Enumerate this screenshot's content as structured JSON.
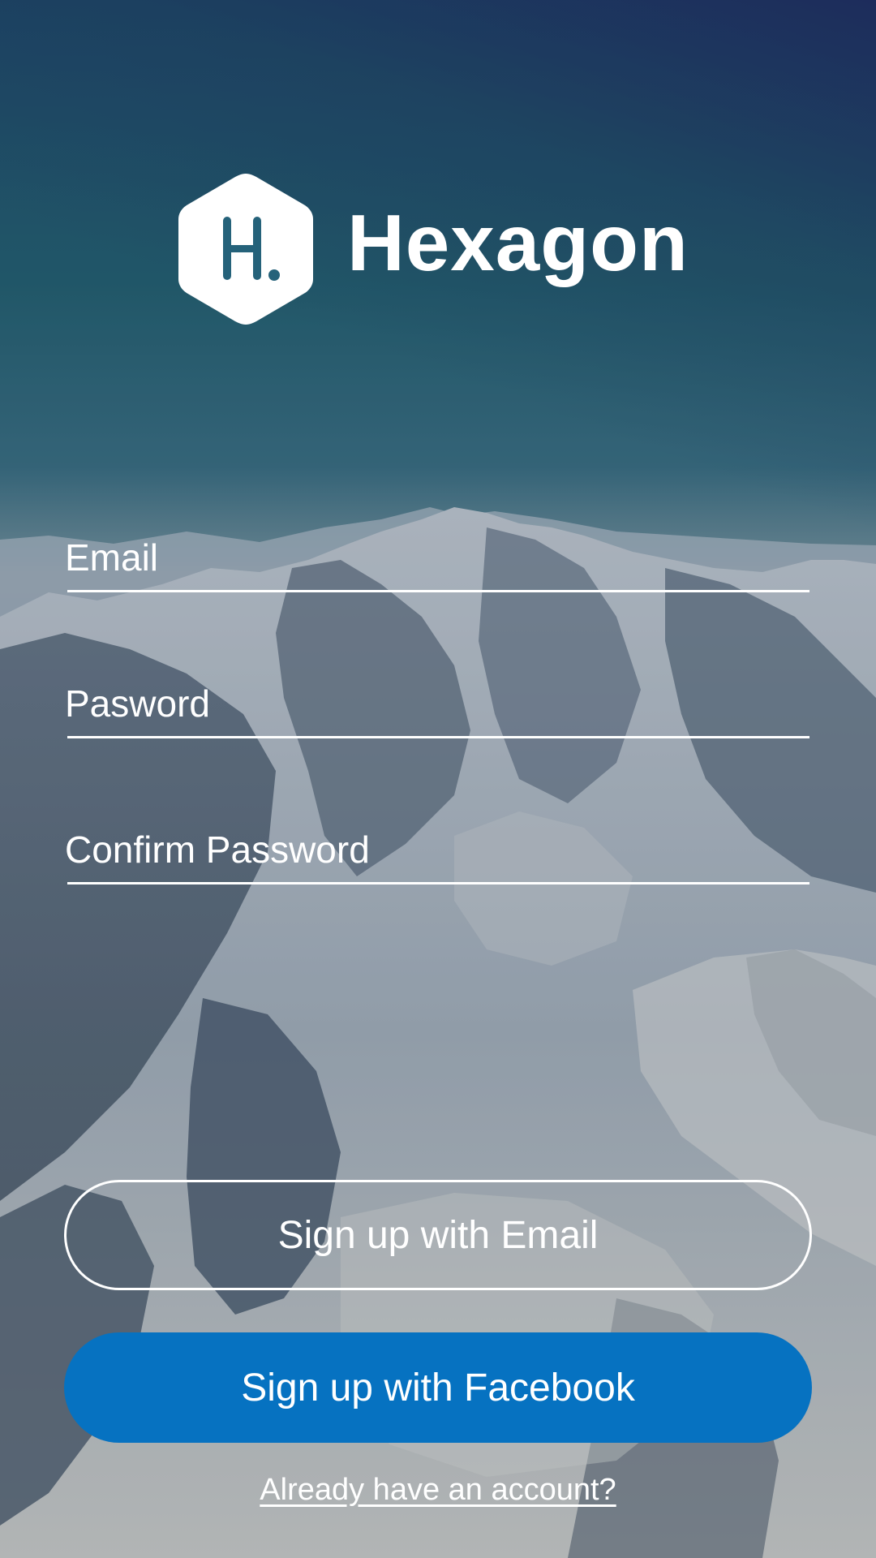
{
  "brand": {
    "logo_letter": "H.",
    "name": "Hexagon"
  },
  "form": {
    "email_placeholder": "Email",
    "password_placeholder": "Pasword",
    "confirm_password_placeholder": "Confirm Password"
  },
  "buttons": {
    "signup_email_label": "Sign up with Email",
    "signup_facebook_label": "Sign up with Facebook"
  },
  "footer": {
    "login_link_label": "Already have an account?"
  },
  "colors": {
    "facebook_blue": "#0672c1",
    "text": "#ffffff"
  },
  "icons": {
    "logo": "hexagon-logo-icon"
  }
}
